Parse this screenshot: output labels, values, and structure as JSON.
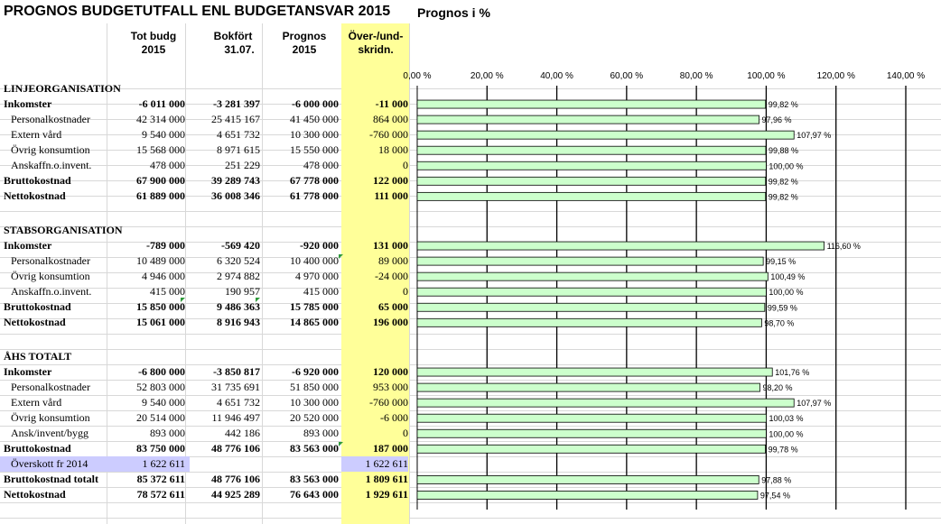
{
  "title": "PROGNOS BUDGETUTFALL  ENL BUDGETANSVAR 2015",
  "chart_title": "Prognos  i  %",
  "columns": {
    "tot_budg": [
      "Tot budg",
      "2015"
    ],
    "bokfort": [
      "Bokfört",
      "31.07."
    ],
    "prognos": [
      "Prognos",
      "2015"
    ],
    "over": [
      "Över-/und-",
      "skridn."
    ]
  },
  "sections": [
    {
      "heading": "LINJEORGANISATION",
      "rows": [
        {
          "label": "Inkomster",
          "tot": "-6 011 000",
          "bok": "-3 281 397",
          "prog": "-6 000 000",
          "over": "-11 000",
          "pct": "99,82 %",
          "bold": true
        },
        {
          "label": "Personalkostnader",
          "tot": "42 314 000",
          "bok": "25 415 167",
          "prog": "41 450 000",
          "over": "864 000",
          "pct": "97,96 %",
          "bold": false
        },
        {
          "label": "Extern vård",
          "tot": "9 540 000",
          "bok": "4 651 732",
          "prog": "10 300 000",
          "over": "-760 000",
          "pct": "107,97 %",
          "bold": false
        },
        {
          "label": "Övrig konsumtion",
          "tot": "15 568 000",
          "bok": "8 971 615",
          "prog": "15 550 000",
          "over": "18 000",
          "pct": "99,88 %",
          "bold": false
        },
        {
          "label": "Anskaffn.o.invent.",
          "tot": "478 000",
          "bok": "251 229",
          "prog": "478 000",
          "over": "0",
          "pct": "100,00 %",
          "bold": false
        },
        {
          "label": "Bruttokostnad",
          "tot": "67 900 000",
          "bok": "39 289 743",
          "prog": "67 778 000",
          "over": "122 000",
          "pct": "99,82 %",
          "bold": true
        },
        {
          "label": "Nettokostnad",
          "tot": "61 889 000",
          "bok": "36 008 346",
          "prog": "61 778 000",
          "over": "111 000",
          "pct": "99,82 %",
          "bold": true
        }
      ]
    },
    {
      "heading": "STABSORGANISATION",
      "rows": [
        {
          "label": "Inkomster",
          "tot": "-789 000",
          "bok": "-569 420",
          "prog": "-920 000",
          "over": "131 000",
          "pct": "116,60 %",
          "bold": true
        },
        {
          "label": "Personalkostnader",
          "tot": "10 489 000",
          "bok": "6 320 524",
          "prog": "10 400 000",
          "over": "89 000",
          "pct": "99,15 %",
          "bold": false
        },
        {
          "label": "Övrig konsumtion",
          "tot": "4 946 000",
          "bok": "2 974 882",
          "prog": "4 970 000",
          "over": "-24 000",
          "pct": "100,49 %",
          "bold": false
        },
        {
          "label": "Anskaffn.o.invent.",
          "tot": "415 000",
          "bok": "190 957",
          "prog": "415 000",
          "over": "0",
          "pct": "100,00 %",
          "bold": false
        },
        {
          "label": "Bruttokostnad",
          "tot": "15 850 000",
          "bok": "9 486 363",
          "prog": "15 785 000",
          "over": "65 000",
          "pct": "99,59 %",
          "bold": true
        },
        {
          "label": "Nettokostnad",
          "tot": "15 061 000",
          "bok": "8 916 943",
          "prog": "14 865 000",
          "over": "196 000",
          "pct": "98,70 %",
          "bold": true
        }
      ]
    },
    {
      "heading": "ÅHS TOTALT",
      "rows": [
        {
          "label": "Inkomster",
          "tot": "-6 800 000",
          "bok": "-3 850 817",
          "prog": "-6 920 000",
          "over": "120 000",
          "pct": "101,76 %",
          "bold": true
        },
        {
          "label": "Personalkostnader",
          "tot": "52 803 000",
          "bok": "31 735 691",
          "prog": "51 850 000",
          "over": "953 000",
          "pct": "98,20 %",
          "bold": false
        },
        {
          "label": "Extern vård",
          "tot": "9 540 000",
          "bok": "4 651 732",
          "prog": "10 300 000",
          "over": "-760 000",
          "pct": "107,97 %",
          "bold": false
        },
        {
          "label": "Övrig konsumtion",
          "tot": "20 514 000",
          "bok": "11 946 497",
          "prog": "20 520 000",
          "over": "-6 000",
          "pct": "100,03 %",
          "bold": false
        },
        {
          "label": "Ansk/invent/bygg",
          "tot": "893 000",
          "bok": "442 186",
          "prog": "893 000",
          "over": "0",
          "pct": "100,00 %",
          "bold": false
        },
        {
          "label": "Bruttokostnad",
          "tot": "83 750 000",
          "bok": "48 776 106",
          "prog": "83 563 000",
          "over": "187 000",
          "pct": "99,78 %",
          "bold": true
        },
        {
          "label": "Överskott fr 2014",
          "tot": "1 622 611",
          "bok": "",
          "prog": "",
          "over": "1 622 611",
          "pct": "",
          "bold": false,
          "highlight": true
        },
        {
          "label": "Bruttokostnad totalt",
          "tot": "85 372 611",
          "bok": "48 776 106",
          "prog": "83 563 000",
          "over": "1 809 611",
          "pct": "97,88 %",
          "bold": true
        },
        {
          "label": "Nettokostnad",
          "tot": "78 572 611",
          "bok": "44 925 289",
          "prog": "76 643 000",
          "over": "1 929 611",
          "pct": "97,54 %",
          "bold": true
        }
      ]
    }
  ],
  "chart_data": {
    "type": "bar",
    "orientation": "horizontal",
    "title": "Prognos  i  %",
    "xlim": [
      0,
      140
    ],
    "ticks": [
      "0,00 %",
      "20,00 %",
      "40,00 %",
      "60,00 %",
      "80,00 %",
      "100,00 %",
      "120,00 %",
      "140,00 %"
    ],
    "tick_values": [
      0,
      20,
      40,
      60,
      80,
      100,
      120,
      140
    ],
    "bar_color": "#ccffcc",
    "values": [
      99.82,
      97.96,
      107.97,
      99.88,
      100.0,
      99.82,
      99.82,
      116.6,
      99.15,
      100.49,
      100.0,
      99.59,
      98.7,
      101.76,
      98.2,
      107.97,
      100.03,
      100.0,
      99.78,
      97.88,
      97.54
    ]
  },
  "colors": {
    "yellow_col": "#ffff99",
    "highlight_row": "#ccccff",
    "bar_fill": "#ccffcc",
    "bar_edge": "#000000"
  }
}
